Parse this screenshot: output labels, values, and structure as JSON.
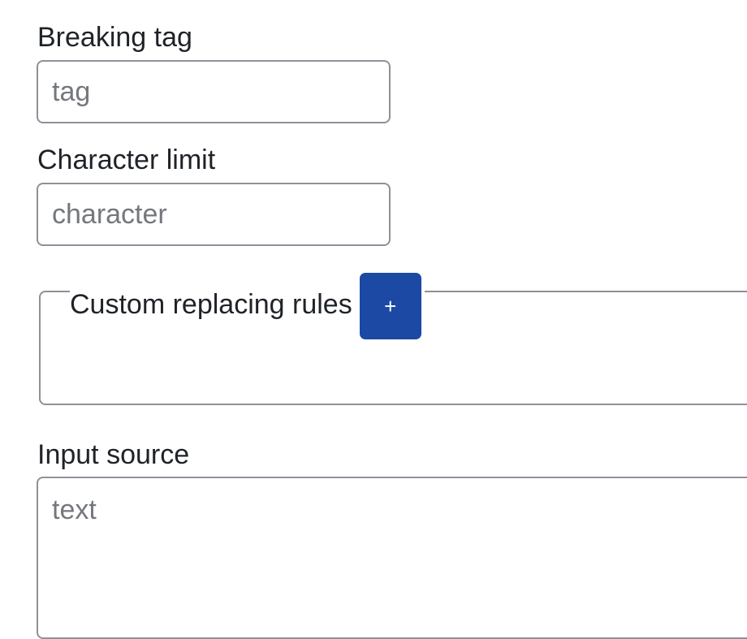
{
  "form": {
    "breaking_tag": {
      "label": "Breaking tag",
      "placeholder": "tag",
      "value": ""
    },
    "character_limit": {
      "label": "Character limit",
      "placeholder": "character",
      "value": ""
    },
    "custom_rules": {
      "legend": "Custom replacing rules",
      "add_button_label": "+"
    },
    "input_source": {
      "label": "Input source",
      "placeholder": "text",
      "value": ""
    }
  },
  "colors": {
    "accent": "#1b49a3",
    "border": "#8f9199",
    "placeholder": "#74787d",
    "text": "#1f2328"
  }
}
